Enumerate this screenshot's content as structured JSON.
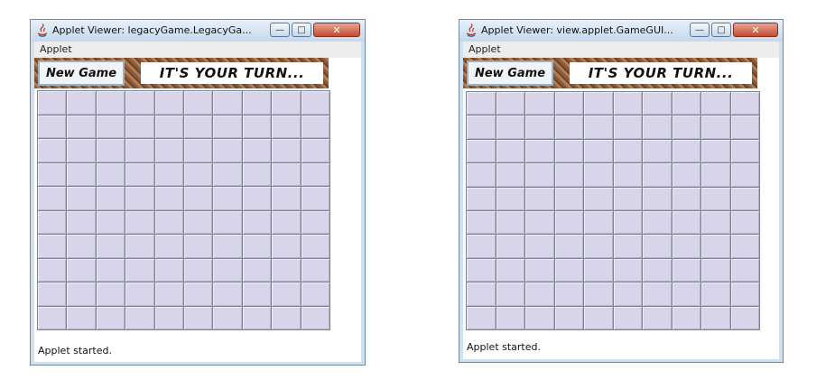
{
  "windows": [
    {
      "title": "Applet Viewer: legacyGame.LegacyGa...",
      "menu": "Applet",
      "new_game_label": "New Game",
      "turn_message": "IT'S YOUR TURN...",
      "status": "Applet started.",
      "grid": {
        "rows": 10,
        "cols": 10
      }
    },
    {
      "title": "Applet Viewer: view.applet.GameGUI...",
      "menu": "Applet",
      "new_game_label": "New Game",
      "turn_message": "IT'S YOUR TURN...",
      "status": "Applet started.",
      "grid": {
        "rows": 10,
        "cols": 10
      }
    }
  ],
  "controls": {
    "minimize": "—",
    "maximize": "□",
    "close": "✕"
  },
  "colors": {
    "cell": "#d8d5ea",
    "grid_line": "#7d8591",
    "toolbar_texture": "#8a5a3a"
  }
}
